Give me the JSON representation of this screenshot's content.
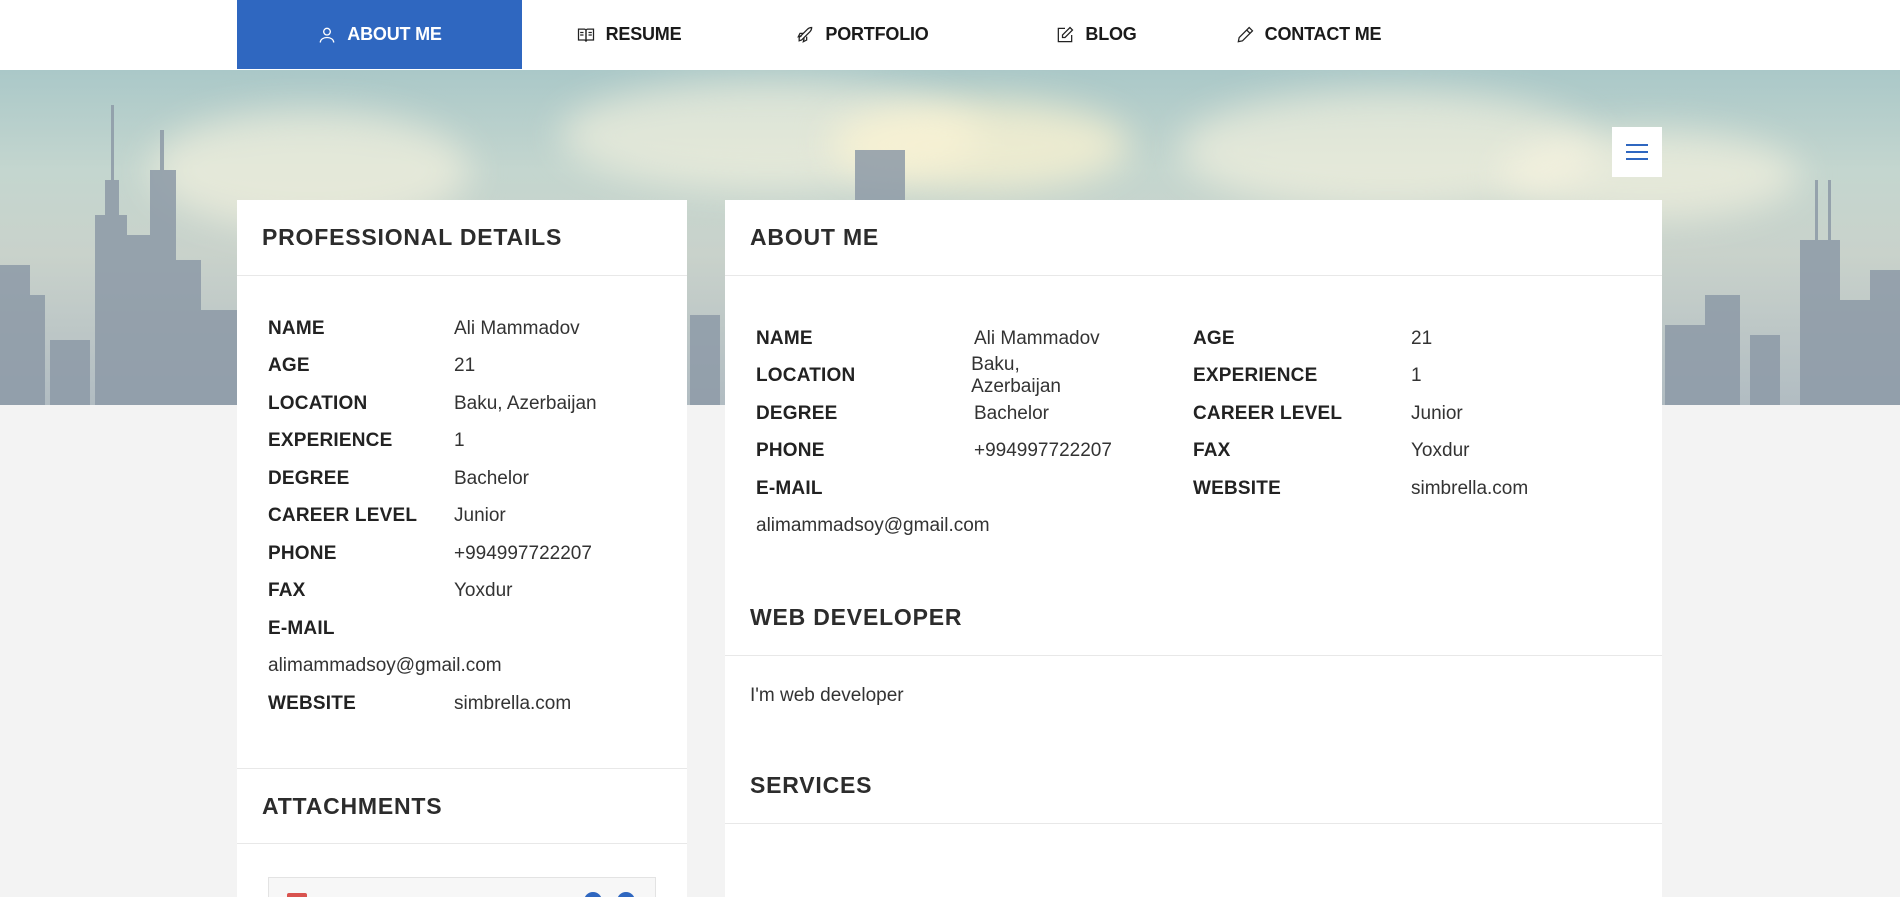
{
  "nav": {
    "items": [
      {
        "label": "ABOUT ME",
        "icon": "user-icon",
        "active": true
      },
      {
        "label": "RESUME",
        "icon": "book-icon",
        "active": false
      },
      {
        "label": "PORTFOLIO",
        "icon": "rocket-icon",
        "active": false
      },
      {
        "label": "BLOG",
        "icon": "edit-icon",
        "active": false
      },
      {
        "label": "CONTACT ME",
        "icon": "pencil-icon",
        "active": false
      }
    ],
    "accent": "#2f67c0"
  },
  "professional": {
    "title": "PROFESSIONAL DETAILS",
    "rows": [
      {
        "key": "NAME",
        "value": "Ali Mammadov"
      },
      {
        "key": "AGE",
        "value": "21"
      },
      {
        "key": "LOCATION",
        "value": "Baku, Azerbaijan"
      },
      {
        "key": "EXPERIENCE",
        "value": "1"
      },
      {
        "key": "DEGREE",
        "value": "Bachelor"
      },
      {
        "key": "CAREER LEVEL",
        "value": "Junior"
      },
      {
        "key": "PHONE",
        "value": "+994997722207"
      },
      {
        "key": "FAX",
        "value": "Yoxdur"
      },
      {
        "key": "E-MAIL",
        "value": "alimammadsoy@gmail.com"
      },
      {
        "key": "WEBSITE",
        "value": "simbrella.com"
      }
    ]
  },
  "attachments": {
    "title": "ATTACHMENTS"
  },
  "about": {
    "title": "ABOUT ME",
    "left": [
      {
        "key": "NAME",
        "value": "Ali Mammadov"
      },
      {
        "key": "LOCATION",
        "value": "Baku, Azerbaijan"
      },
      {
        "key": "DEGREE",
        "value": "Bachelor"
      },
      {
        "key": "PHONE",
        "value": "+994997722207"
      },
      {
        "key": "E-MAIL",
        "value": "alimammadsoy@gmail.com"
      }
    ],
    "right": [
      {
        "key": "AGE",
        "value": "21"
      },
      {
        "key": "EXPERIENCE",
        "value": "1"
      },
      {
        "key": "CAREER LEVEL",
        "value": "Junior"
      },
      {
        "key": "FAX",
        "value": "Yoxdur"
      },
      {
        "key": "WEBSITE",
        "value": "simbrella.com"
      }
    ]
  },
  "web_developer": {
    "title": "WEB DEVELOPER",
    "text": "I'm web developer"
  },
  "services": {
    "title": "SERVICES"
  }
}
